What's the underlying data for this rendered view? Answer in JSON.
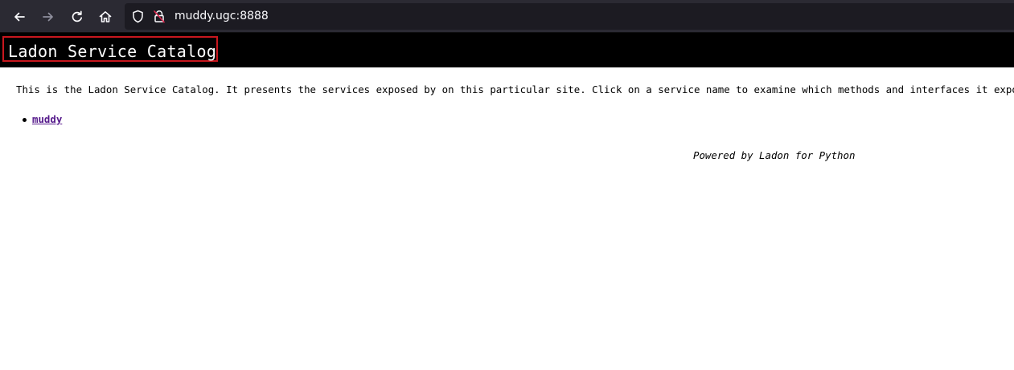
{
  "browser": {
    "url": "muddy.ugc:8888",
    "icons": {
      "back": "arrow-left-icon",
      "forward": "arrow-right-icon",
      "reload": "reload-icon",
      "home": "home-icon",
      "shield": "shield-icon",
      "lock": "insecure-lock-icon"
    }
  },
  "page": {
    "title": "Ladon Service Catalog",
    "intro": "This is the Ladon Service Catalog. It presents the services exposed by on this particular site. Click on a service name to examine which methods and interfaces it exposes.",
    "services": [
      {
        "name": "muddy"
      }
    ],
    "footer": "Powered by Ladon for Python"
  },
  "colors": {
    "toolbar": "#2b2a33",
    "urlbar": "#1c1b22",
    "header_bar": "#000000",
    "highlight_box": "#c8171e",
    "visited_link": "#551a8b"
  }
}
